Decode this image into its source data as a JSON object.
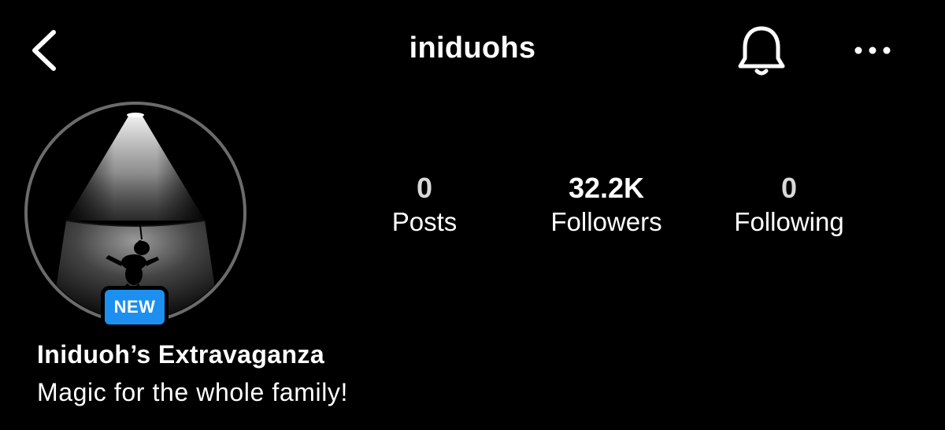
{
  "header": {
    "username": "iniduohs",
    "back_icon": "chevron-left-icon",
    "notification_icon": "bell-icon",
    "more_icon": "more-horizontal-icon"
  },
  "profile": {
    "badge": "NEW",
    "display_name": "Iniduoh’s Extravaganza",
    "bio": "Magic for the whole family!"
  },
  "stats": [
    {
      "value": "0",
      "label": "Posts"
    },
    {
      "value": "32.2K",
      "label": "Followers"
    },
    {
      "value": "0",
      "label": "Following"
    }
  ],
  "colors": {
    "background": "#000000",
    "text": "#ffffff",
    "badge": "#1d8ff0"
  }
}
